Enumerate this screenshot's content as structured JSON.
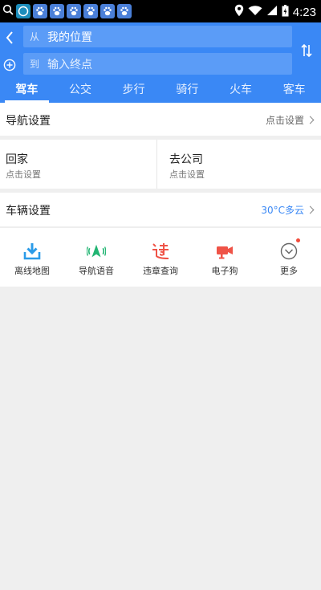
{
  "status_bar": {
    "time": "4:23",
    "notification_icons": [
      "app-icon",
      "baidu-paw-icon",
      "baidu-paw-icon",
      "baidu-paw-icon",
      "baidu-paw-icon",
      "baidu-paw-icon",
      "baidu-paw-icon"
    ]
  },
  "route": {
    "from_prefix": "从",
    "from_value": "我的位置",
    "to_prefix": "到",
    "to_placeholder": "输入终点"
  },
  "tabs": [
    {
      "label": "驾车",
      "active": true
    },
    {
      "label": "公交",
      "active": false
    },
    {
      "label": "步行",
      "active": false
    },
    {
      "label": "骑行",
      "active": false
    },
    {
      "label": "火车",
      "active": false
    },
    {
      "label": "客车",
      "active": false
    }
  ],
  "nav_settings": {
    "label": "导航设置",
    "action": "点击设置"
  },
  "places": {
    "home": {
      "title": "回家",
      "sub": "点击设置"
    },
    "work": {
      "title": "去公司",
      "sub": "点击设置"
    }
  },
  "vehicle_settings": {
    "label": "车辆设置",
    "weather": "30°C多云"
  },
  "tools": [
    {
      "label": "离线地图",
      "icon": "download-icon",
      "color": "#2b9be8"
    },
    {
      "label": "导航语音",
      "icon": "voice-nav-icon",
      "color": "#22b573"
    },
    {
      "label": "违章查询",
      "icon": "violation-icon",
      "color": "#ef5347"
    },
    {
      "label": "电子狗",
      "icon": "camera-icon",
      "color": "#ef5347"
    },
    {
      "label": "更多",
      "icon": "more-icon",
      "color": "#666666"
    }
  ],
  "colors": {
    "header": "#3a88f5",
    "field": "#5b9cf7",
    "background": "#efefef"
  }
}
